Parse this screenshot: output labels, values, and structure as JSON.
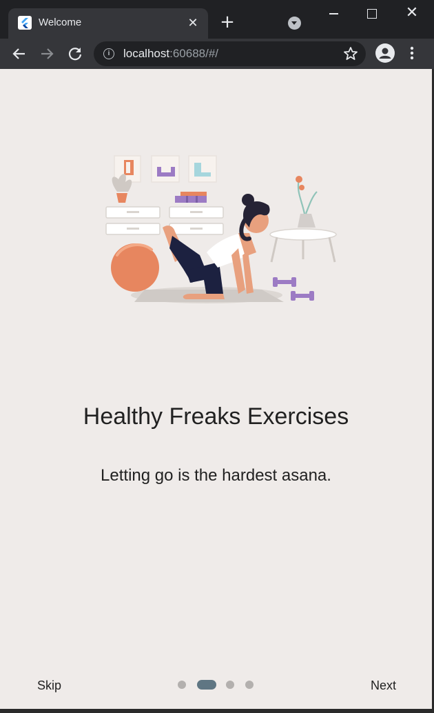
{
  "browser": {
    "tab_title": "Welcome",
    "tab_close": "✕",
    "new_tab": "+",
    "url_host": "localhost",
    "url_rest": ":60688/#/",
    "info_glyph": "i",
    "close_glyph": "✕"
  },
  "onboarding": {
    "title": "Healthy Freaks Exercises",
    "subtitle": "Letting go is the hardest asana.",
    "skip_label": "Skip",
    "next_label": "Next",
    "page_count": 4,
    "current_page": 2
  },
  "colors": {
    "app_background": "#efebe9",
    "active_dot": "#5f7683",
    "inactive_dot": "#b3b0ae",
    "text": "#212121"
  }
}
